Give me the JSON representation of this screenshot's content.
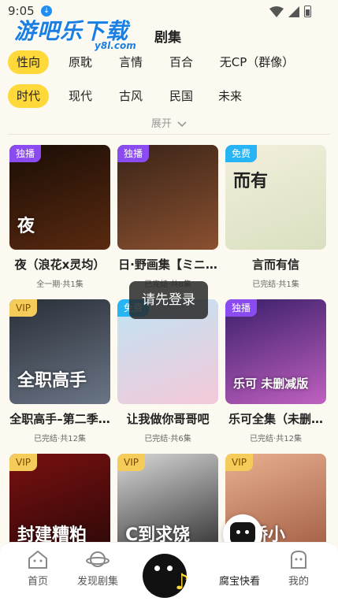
{
  "status": {
    "time": "9:05"
  },
  "logo": {
    "main": "游吧乐下载",
    "sub": "y8l.com"
  },
  "page": {
    "title": "剧集"
  },
  "filters": {
    "row1": [
      "性向",
      "原耽",
      "言情",
      "百合",
      "无CP（群像）"
    ],
    "row2": [
      "时代",
      "现代",
      "古风",
      "民国",
      "未来"
    ],
    "expand_label": "展开"
  },
  "cards": [
    {
      "badge": "独播",
      "badge_type": "excl",
      "title": "夜（浪花x灵均）",
      "sub": "全一期·共1集",
      "art": "夜",
      "colors": [
        "#1a0d06",
        "#5a2a10"
      ]
    },
    {
      "badge": "独播",
      "badge_type": "excl",
      "title": "日·野画集【ミニ…",
      "sub": "已完结·共8集",
      "art": "",
      "colors": [
        "#3a2418",
        "#8a5030"
      ]
    },
    {
      "badge": "免费",
      "badge_type": "free",
      "title": "言而有信",
      "sub": "已完结·共1集",
      "art": "而有",
      "colors": [
        "#f3efdc",
        "#d9e0c0"
      ]
    },
    {
      "badge": "VIP",
      "badge_type": "vip",
      "title": "全职高手–第二季…",
      "sub": "已完结·共12集",
      "art": "全职高手",
      "colors": [
        "#2a2f38",
        "#6a7585"
      ]
    },
    {
      "badge": "免费",
      "badge_type": "free",
      "title": "让我做你哥哥吧",
      "sub": "已完结·共6集",
      "art": "",
      "colors": [
        "#bfe4f4",
        "#f4c8d8"
      ]
    },
    {
      "badge": "独播",
      "badge_type": "excl",
      "title": "乐可全集（未删…",
      "sub": "已完结·共12集",
      "art": "乐可 未删减版",
      "colors": [
        "#3a1f6a",
        "#c060c0"
      ]
    },
    {
      "badge": "VIP",
      "badge_type": "vip",
      "title": "",
      "sub": "",
      "art": "封建糟粕",
      "colors": [
        "#7a1010",
        "#2a0808"
      ]
    },
    {
      "badge": "VIP",
      "badge_type": "vip",
      "title": "",
      "sub": "",
      "art": "C到求饶",
      "colors": [
        "#d8d8d8",
        "#2a2a2a"
      ]
    },
    {
      "badge": "VIP",
      "badge_type": "vip",
      "title": "",
      "sub": "",
      "art": "娇娇小",
      "colors": [
        "#e8b090",
        "#a05a40"
      ]
    }
  ],
  "toast": "请先登录",
  "nav": {
    "home": "首页",
    "discover": "发现剧集",
    "kuaikan": "腐宝快看",
    "mine": "我的"
  },
  "colors": {
    "accent": "#ffd83a",
    "badge_excl": "#8a4cf0",
    "badge_free": "#27b4f5",
    "badge_vip": "#f5cc5a"
  }
}
